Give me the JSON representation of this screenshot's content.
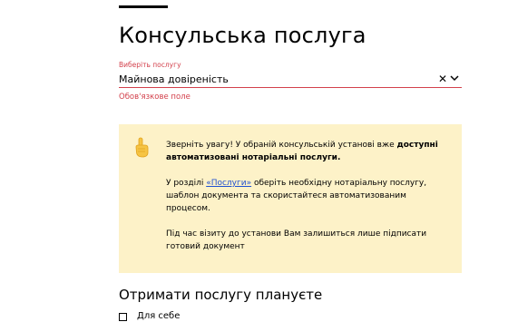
{
  "page": {
    "title": "Консульська послуга"
  },
  "service_select": {
    "caption": "Виберіть послугу",
    "value": "Майнова довіреність",
    "clear_icon": "close-icon",
    "open_icon": "chevron-down-icon",
    "error": "Обов'язкове поле",
    "error_color": "#d3414c"
  },
  "notice": {
    "icon": "raised-hand-icon",
    "background": "#fdf2c8",
    "p1_text": "Зверніть увагу! У обраній консульській установі вже ",
    "p1_bold": "доступні автоматизовані нотаріальні послуги.",
    "p2_before": "У розділі ",
    "p2_link": "«Послуги»",
    "p2_after": " оберіть необхідну нотаріальну послугу, шаблон документа та скористайтеся автоматизованим процесом.",
    "p3": "Під час візиту до установи Вам залишиться лише підписати готовий документ",
    "link_color": "#1f4fd1"
  },
  "receive": {
    "title": "Отримати послугу плануєте",
    "option_label": "Для себе"
  }
}
